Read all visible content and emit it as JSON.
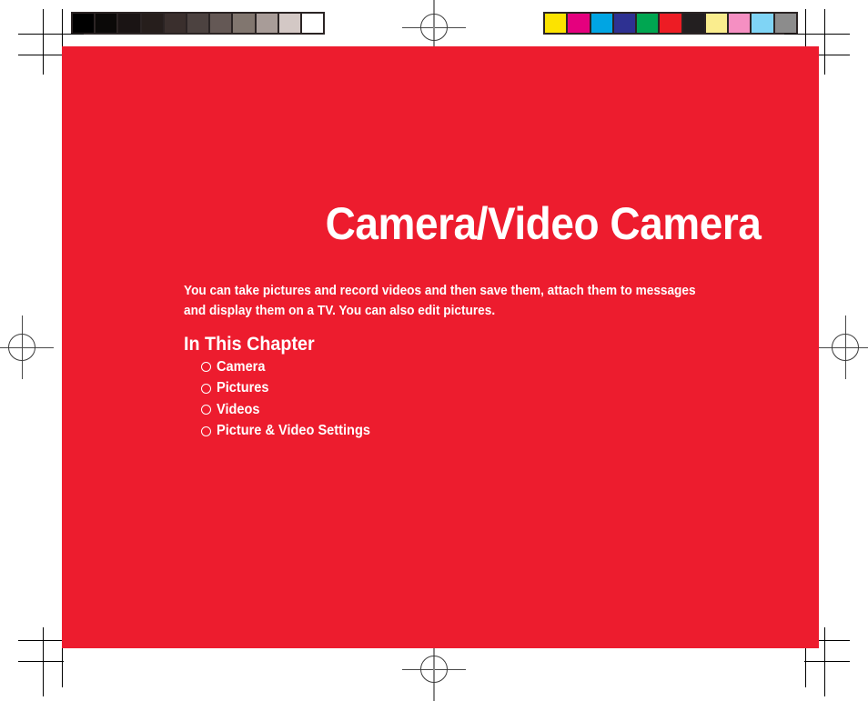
{
  "page": {
    "background_color": "#FFFFFF",
    "panel_color": "#ED1C2E",
    "text_color": "#FFFFFF"
  },
  "chapter": {
    "title": "Camera/Video Camera",
    "intro": "You can take pictures and record videos and then save them, attach them to messages and display them on a TV. You can also edit pictures.",
    "section_heading": "In This Chapter",
    "items": [
      {
        "label": "Camera"
      },
      {
        "label": "Pictures"
      },
      {
        "label": "Videos"
      },
      {
        "label": "Picture & Video Settings"
      }
    ]
  },
  "calibration": {
    "grayscale_strip": {
      "frame_color": "#2B2424",
      "swatches": [
        "#000000",
        "#0B0908",
        "#1A1414",
        "#261E1C",
        "#3A2F2D",
        "#4C4240",
        "#645855",
        "#81766F",
        "#A89C98",
        "#D3C8C5",
        "#FFFFFF"
      ]
    },
    "color_strip": {
      "frame_color": "#2B2424",
      "swatches": [
        "#FCE300",
        "#E5007E",
        "#00A5E3",
        "#2E3192",
        "#00A651",
        "#ED1C24",
        "#231F20",
        "#FAED8E",
        "#F58FC2",
        "#7FD4F5",
        "#8C8C8C"
      ]
    }
  },
  "marks": {
    "registration_icon": "registration-target-icon",
    "crop_icon": "crop-mark-icon"
  }
}
